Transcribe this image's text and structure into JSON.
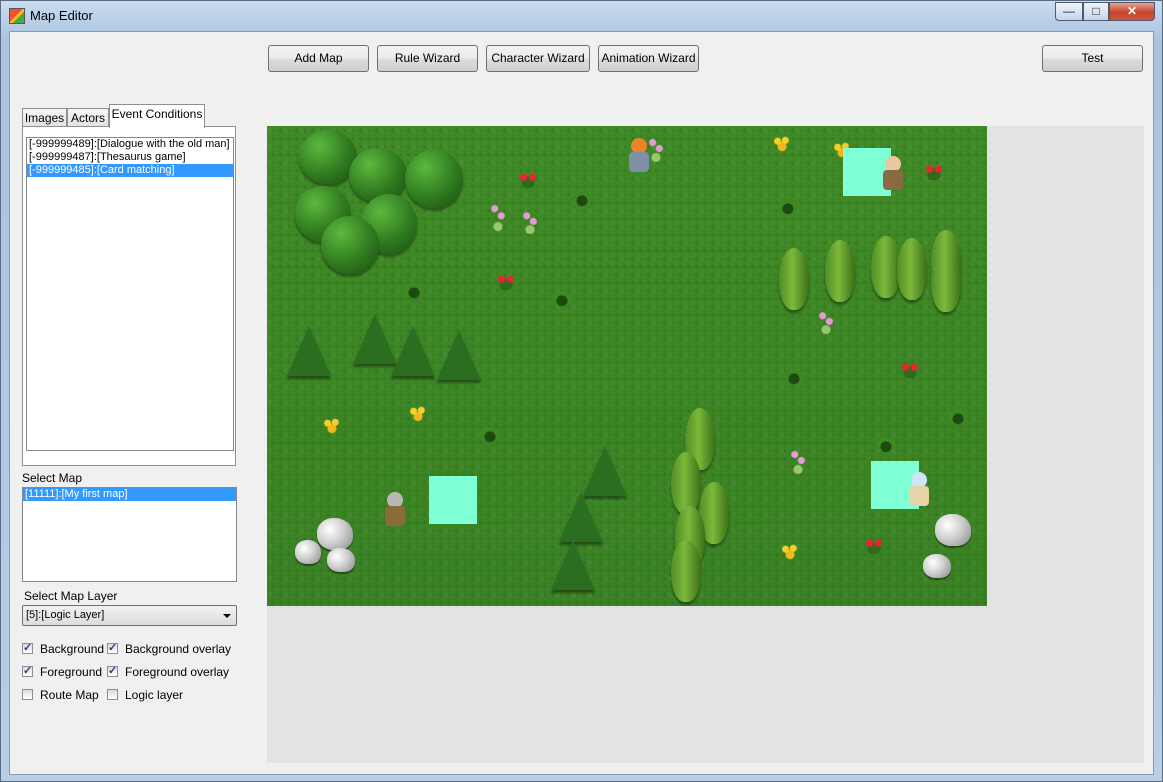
{
  "window": {
    "title": "Map Editor",
    "minimize_glyph": "—",
    "maximize_glyph": "□",
    "close_glyph": "✕"
  },
  "toolbar": {
    "add_map": "Add Map",
    "rule_wizard": "Rule Wizard",
    "character_wizard": "Character Wizard",
    "animation_wizard": "Animation Wizard",
    "test": "Test"
  },
  "tabs": [
    {
      "label": "Images"
    },
    {
      "label": "Actors"
    },
    {
      "label": "Event Conditions",
      "active": true
    }
  ],
  "event_conditions": {
    "items": [
      {
        "label": "[-999999489]:[Dialogue with the old man]",
        "selected": false
      },
      {
        "label": "[-999999487]:[Thesaurus game]",
        "selected": false
      },
      {
        "label": "[-999999485]:[Card matching]",
        "selected": true
      }
    ]
  },
  "select_map": {
    "label": "Select Map",
    "items": [
      {
        "label": "[11111]:[My first map]",
        "selected": true
      }
    ]
  },
  "select_layer": {
    "label": "Select Map Layer",
    "value": "[5]:[Logic Layer]"
  },
  "layers": {
    "background": {
      "label": "Background",
      "checked": true
    },
    "background_overlay": {
      "label": "Background overlay",
      "checked": true
    },
    "foreground": {
      "label": "Foreground",
      "checked": true
    },
    "foreground_overlay": {
      "label": "Foreground overlay",
      "checked": true
    },
    "route_map": {
      "label": "Route Map",
      "checked": false
    },
    "logic_layer": {
      "label": "Logic layer",
      "checked": false
    }
  },
  "colors": {
    "selection": "#3399ff",
    "logic_marker": "#7fffd4",
    "grass": "#3a8224"
  }
}
